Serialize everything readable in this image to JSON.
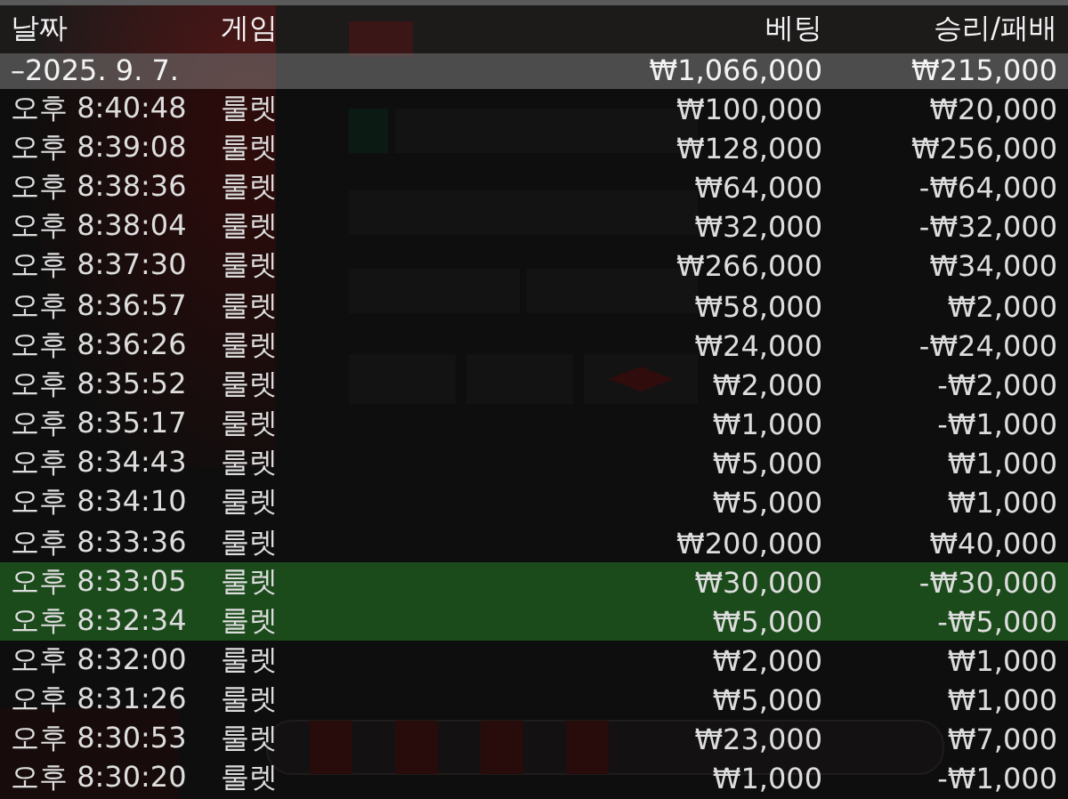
{
  "table_header": {
    "date": "날짜",
    "game": "게임",
    "bet": "베팅",
    "result": "승리/패배"
  },
  "date_group": {
    "label": "–2025. 9. 7.",
    "bet": "₩1,066,000",
    "result": "₩215,000"
  },
  "rows": [
    {
      "time": "오후 8:40:48",
      "game": "룰렛",
      "bet": "₩100,000",
      "result": "₩20,000",
      "highlighted": false
    },
    {
      "time": "오후 8:39:08",
      "game": "룰렛",
      "bet": "₩128,000",
      "result": "₩256,000",
      "highlighted": false
    },
    {
      "time": "오후 8:38:36",
      "game": "룰렛",
      "bet": "₩64,000",
      "result": "-₩64,000",
      "highlighted": false
    },
    {
      "time": "오후 8:38:04",
      "game": "룰렛",
      "bet": "₩32,000",
      "result": "-₩32,000",
      "highlighted": false
    },
    {
      "time": "오후 8:37:30",
      "game": "룰렛",
      "bet": "₩266,000",
      "result": "₩34,000",
      "highlighted": false
    },
    {
      "time": "오후 8:36:57",
      "game": "룰렛",
      "bet": "₩58,000",
      "result": "₩2,000",
      "highlighted": false
    },
    {
      "time": "오후 8:36:26",
      "game": "룰렛",
      "bet": "₩24,000",
      "result": "-₩24,000",
      "highlighted": false
    },
    {
      "time": "오후 8:35:52",
      "game": "룰렛",
      "bet": "₩2,000",
      "result": "-₩2,000",
      "highlighted": false
    },
    {
      "time": "오후 8:35:17",
      "game": "룰렛",
      "bet": "₩1,000",
      "result": "-₩1,000",
      "highlighted": false
    },
    {
      "time": "오후 8:34:43",
      "game": "룰렛",
      "bet": "₩5,000",
      "result": "₩1,000",
      "highlighted": false
    },
    {
      "time": "오후 8:34:10",
      "game": "룰렛",
      "bet": "₩5,000",
      "result": "₩1,000",
      "highlighted": false
    },
    {
      "time": "오후 8:33:36",
      "game": "룰렛",
      "bet": "₩200,000",
      "result": "₩40,000",
      "highlighted": false
    },
    {
      "time": "오후 8:33:05",
      "game": "룰렛",
      "bet": "₩30,000",
      "result": "-₩30,000",
      "highlighted": true
    },
    {
      "time": "오후 8:32:34",
      "game": "룰렛",
      "bet": "₩5,000",
      "result": "-₩5,000",
      "highlighted": true
    },
    {
      "time": "오후 8:32:00",
      "game": "룰렛",
      "bet": "₩2,000",
      "result": "₩1,000",
      "highlighted": false
    },
    {
      "time": "오후 8:31:26",
      "game": "룰렛",
      "bet": "₩5,000",
      "result": "₩1,000",
      "highlighted": false
    },
    {
      "time": "오후 8:30:53",
      "game": "룰렛",
      "bet": "₩23,000",
      "result": "₩7,000",
      "highlighted": false
    },
    {
      "time": "오후 8:30:20",
      "game": "룰렛",
      "bet": "₩1,000",
      "result": "-₩1,000",
      "highlighted": false
    }
  ]
}
